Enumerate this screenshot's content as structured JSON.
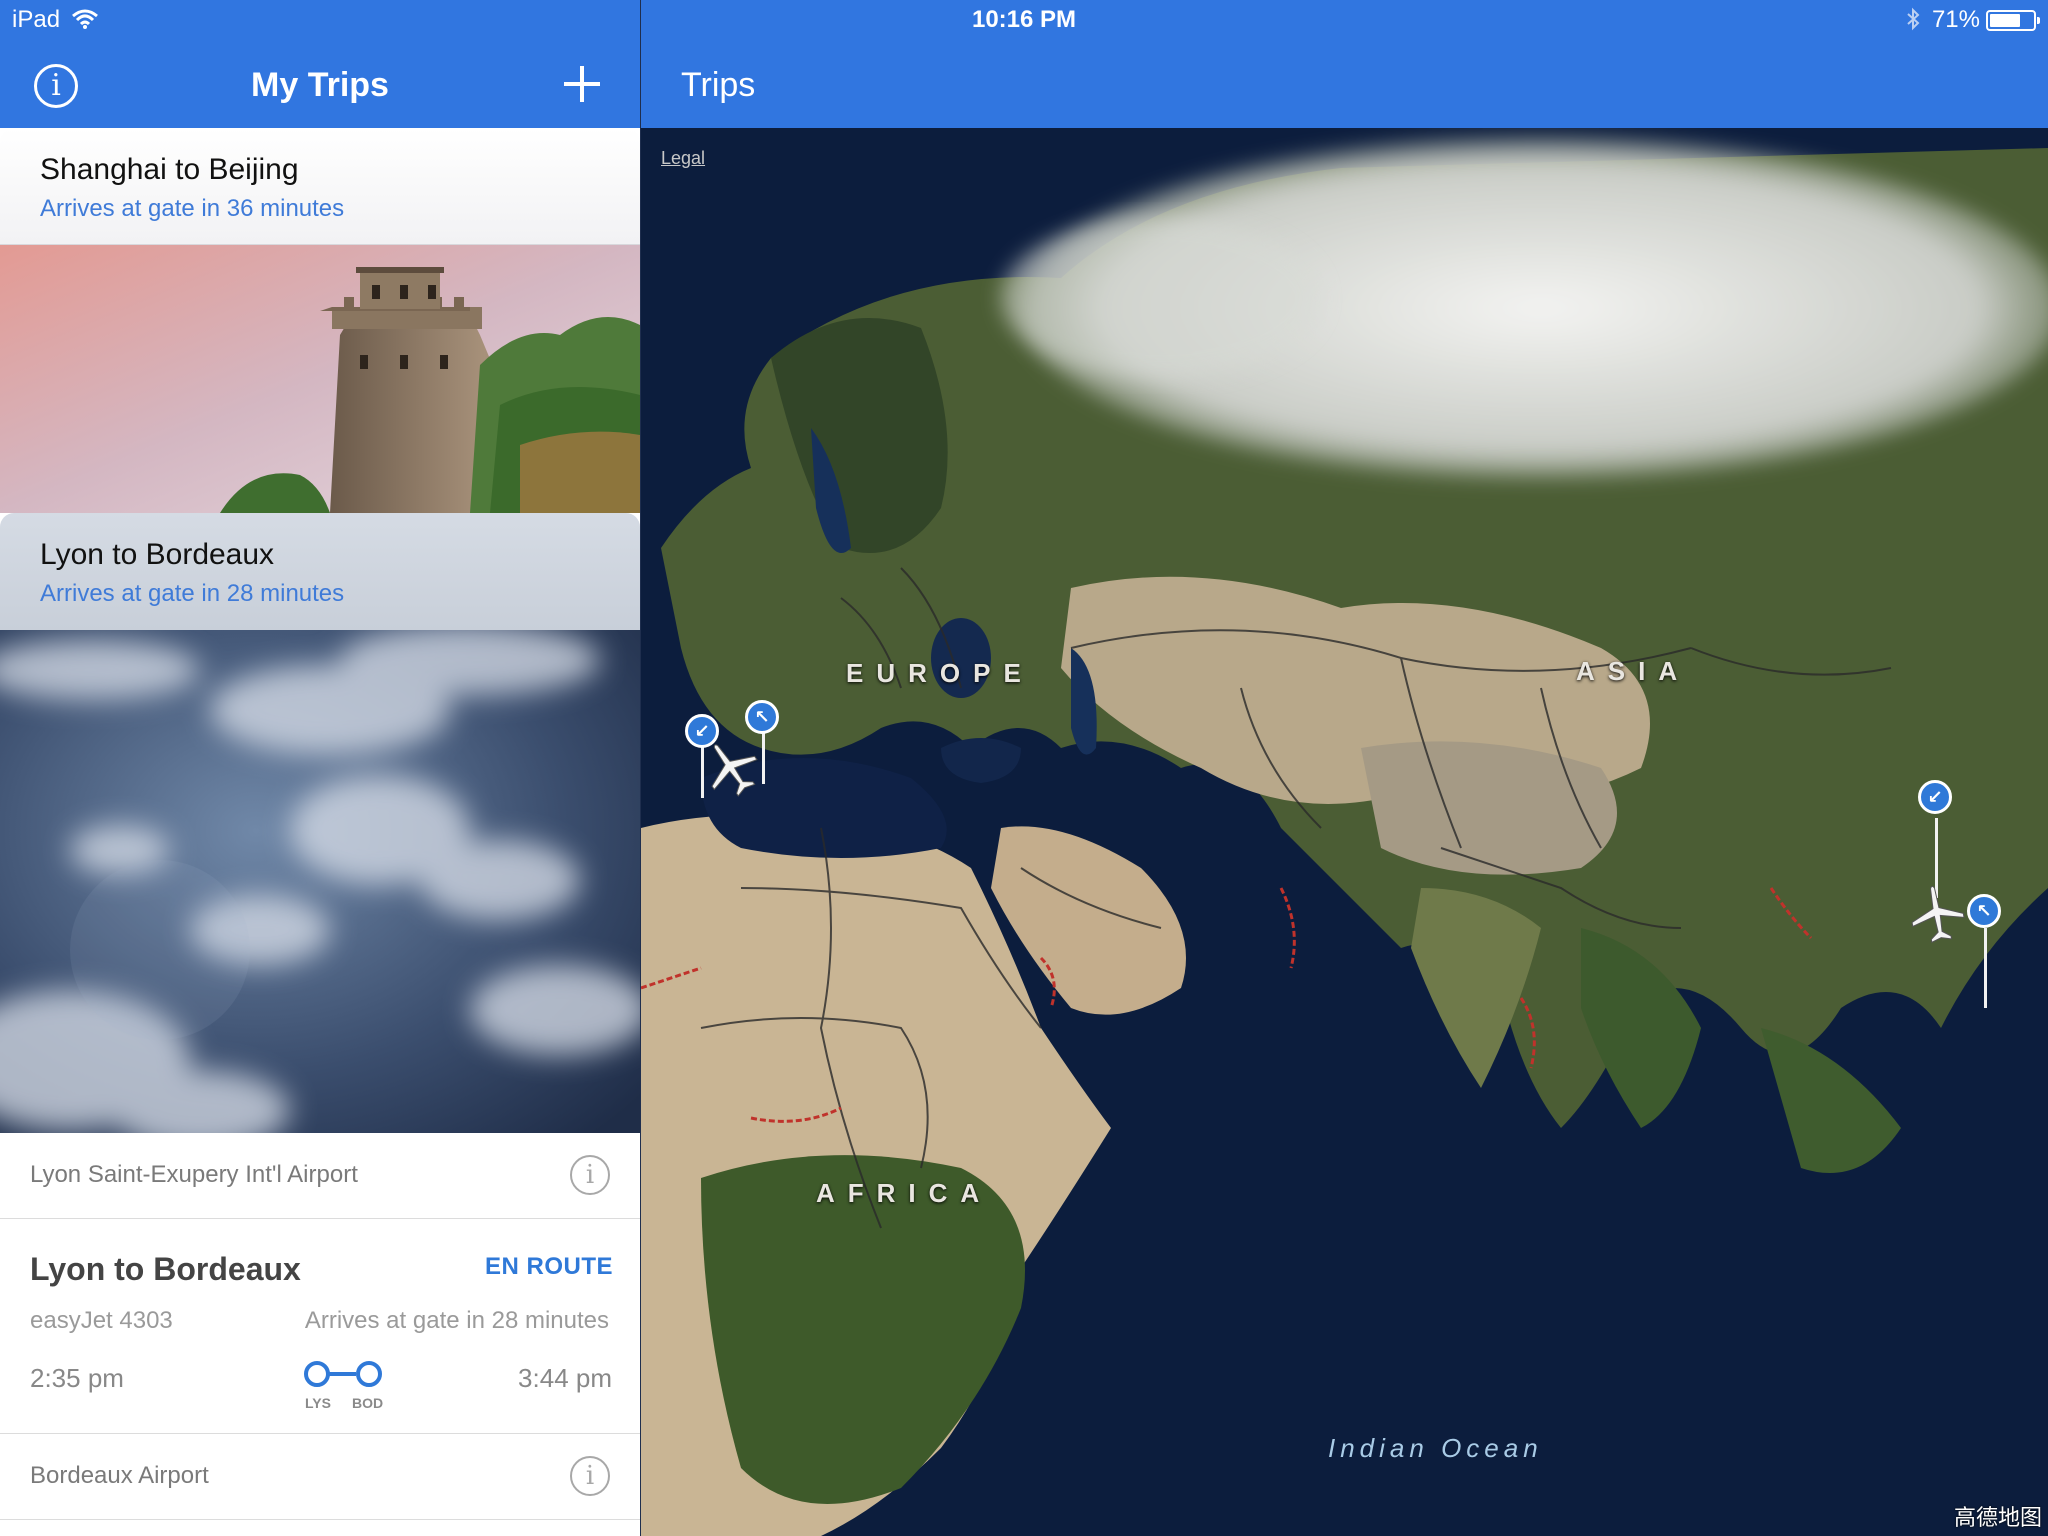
{
  "status_bar": {
    "device": "iPad",
    "time": "10:16 PM",
    "battery": "71%",
    "battery_level": 0.71
  },
  "left_nav": {
    "title": "My Trips"
  },
  "trips": [
    {
      "name": "Shanghai to Beijing",
      "subtitle": "Arrives at gate in 36 minutes"
    },
    {
      "name": "Lyon to Bordeaux",
      "subtitle": "Arrives at gate in 28 minutes"
    }
  ],
  "detail": {
    "origin_airport": "Lyon Saint-Exupery Int'l Airport",
    "route": "Lyon to Bordeaux",
    "status": "EN ROUTE",
    "flight_number": "easyJet 4303",
    "arrival": "Arrives at gate in 28 minutes",
    "departure_time": "2:35 pm",
    "arrival_time": "3:44 pm",
    "origin_code": "LYS",
    "destination_code": "BOD",
    "destination_airport": "Bordeaux Airport"
  },
  "map": {
    "title": "Trips",
    "legal": "Legal",
    "labels": {
      "europe": "EUROPE",
      "asia": "ASIA",
      "africa": "AFRICA",
      "ocean": "Indian Ocean"
    },
    "watermark": "高德地图"
  },
  "colors": {
    "nav_blue": "#3176e0",
    "accent_blue": "#2f79d8"
  }
}
